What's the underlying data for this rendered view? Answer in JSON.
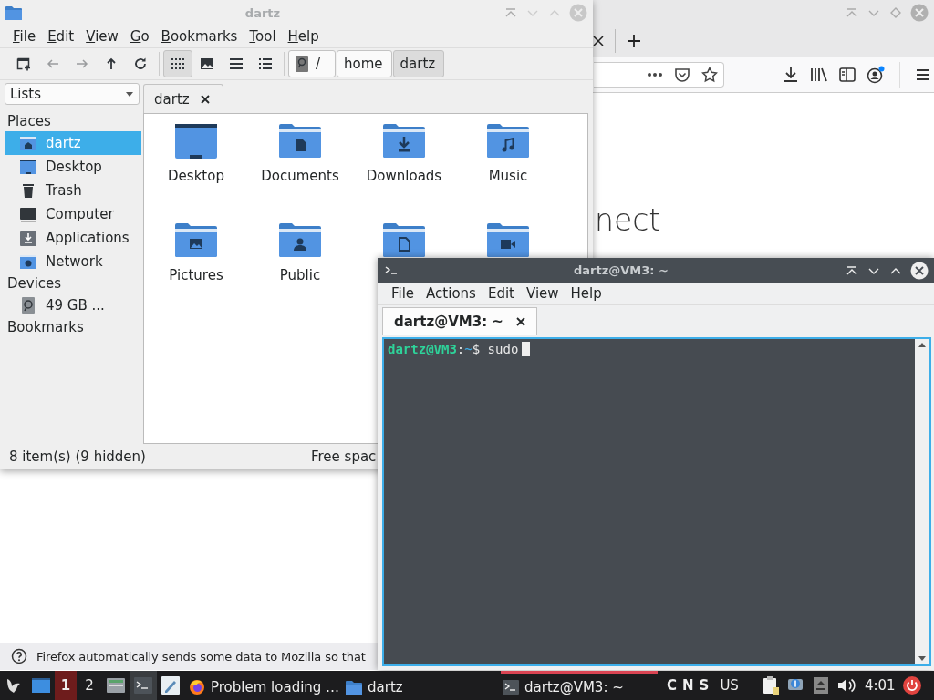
{
  "browser": {
    "heading": "nect",
    "notification": "Firefox automatically sends some data to Mozilla so that"
  },
  "file_manager": {
    "title": "dartz",
    "menu": [
      "File",
      "Edit",
      "View",
      "Go",
      "Bookmarks",
      "Tool",
      "Help"
    ],
    "view_modes": [
      {
        "kind": "icons",
        "selected": true
      },
      {
        "kind": "thumbnails",
        "selected": false
      },
      {
        "kind": "compact",
        "selected": false
      },
      {
        "kind": "details",
        "selected": false
      }
    ],
    "path": [
      {
        "label": "/",
        "kind": "root",
        "selected": false
      },
      {
        "label": "home",
        "kind": "folder",
        "selected": false
      },
      {
        "label": "dartz",
        "kind": "folder",
        "selected": true
      }
    ],
    "side_pane": "Lists",
    "tab": "dartz",
    "sidebar": [
      {
        "title": "Places",
        "items": [
          {
            "label": "dartz",
            "kind": "home",
            "selected": true
          },
          {
            "label": "Desktop",
            "kind": "desktop",
            "selected": false
          },
          {
            "label": "Trash",
            "kind": "trash",
            "selected": false
          },
          {
            "label": "Computer",
            "kind": "computer",
            "selected": false
          },
          {
            "label": "Applications",
            "kind": "applications",
            "selected": false
          },
          {
            "label": "Network",
            "kind": "network",
            "selected": false
          }
        ]
      },
      {
        "title": "Devices",
        "items": [
          {
            "label": "49 GB ...",
            "kind": "drive",
            "selected": false
          }
        ]
      },
      {
        "title": "Bookmarks"
      }
    ],
    "files": [
      {
        "name": "Desktop",
        "kind": "desktop"
      },
      {
        "name": "Documents",
        "kind": "documents"
      },
      {
        "name": "Downloads",
        "kind": "downloads"
      },
      {
        "name": "Music",
        "kind": "music"
      },
      {
        "name": "Pictures",
        "kind": "pictures"
      },
      {
        "name": "Public",
        "kind": "public"
      },
      {
        "kind": "templates"
      },
      {
        "kind": "videos"
      }
    ],
    "status": "8 item(s) (9 hidden)",
    "free_space": "Free spac"
  },
  "terminal": {
    "title": "dartz@VM3: ~",
    "menu": [
      "File",
      "Actions",
      "Edit",
      "View",
      "Help"
    ],
    "tab": "dartz@VM3: ~",
    "line": {
      "user_host": "dartz@VM3",
      "separator": ":",
      "directory": "~",
      "prompt": "$",
      "command": "sudo"
    }
  },
  "taskbar": {
    "workspaces": [
      {
        "label": "1",
        "selected": true
      },
      {
        "label": "2",
        "selected": false
      }
    ],
    "tasks": [
      {
        "label": "Problem loading …",
        "kind": "browser",
        "selected": false
      },
      {
        "label": "dartz",
        "kind": "folder",
        "selected": false
      },
      {
        "label": "dartz@VM3: ~",
        "kind": "terminal",
        "selected": true
      }
    ],
    "lock_keys": [
      "C",
      "N",
      "S"
    ],
    "keyboard_layout": "US",
    "clock": "4:01"
  }
}
